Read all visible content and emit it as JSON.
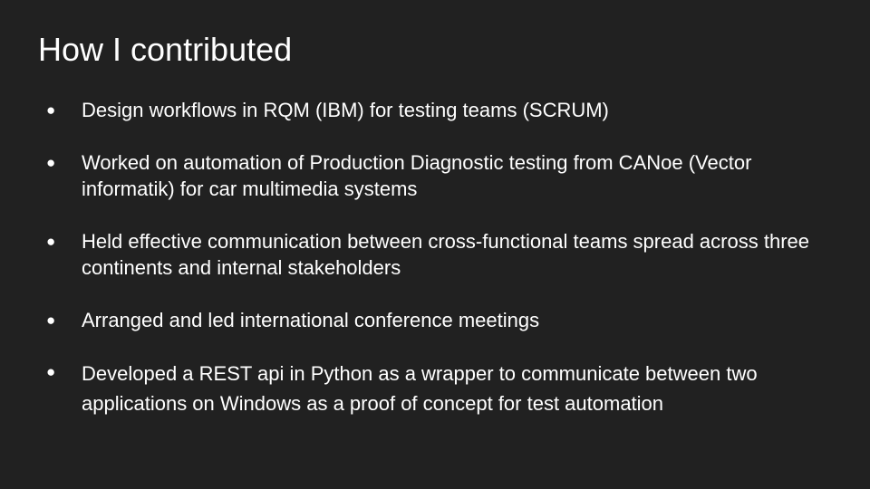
{
  "slide": {
    "title": "How I contributed",
    "bullet_marker": "●",
    "bullets": [
      "Design workflows in RQM (IBM) for testing teams (SCRUM)",
      "Worked on automation of Production Diagnostic testing from CANoe (Vector informatik) for car multimedia systems",
      "Held effective communication between cross-functional teams spread across three continents and internal stakeholders",
      "Arranged and led international conference meetings",
      "Developed a REST api in Python as a wrapper to communicate between two applications on Windows as a proof of concept for test automation"
    ],
    "colors": {
      "background": "#212121",
      "text": "#ffffff"
    }
  }
}
